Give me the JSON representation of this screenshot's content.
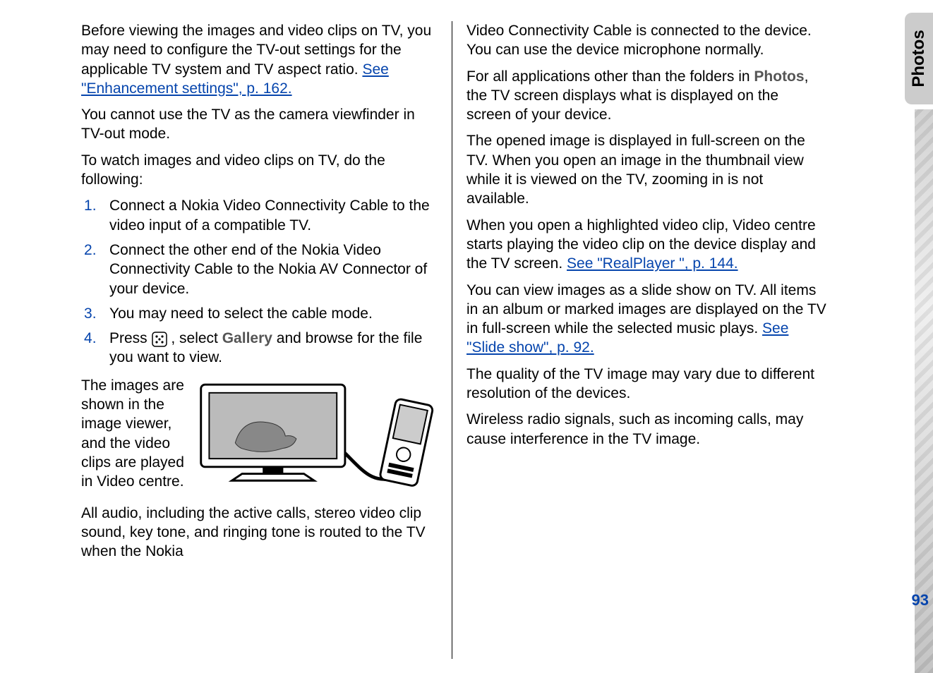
{
  "sideTab": "Photos",
  "pageNumber": "93",
  "left": {
    "p1_prefix": "Before viewing the images and video clips on TV, you may need to configure the TV-out settings for the applicable TV system and TV aspect ratio. ",
    "p1_link": "See \"Enhancement settings\", p. 162.",
    "p2": "You cannot use the TV as the camera viewfinder in TV-out mode.",
    "p3": "To watch images and video clips on TV, do the following:",
    "li1": "Connect a Nokia Video Connectivity Cable to the video input of a compatible TV.",
    "li2": "Connect the other end of the Nokia Video Connectivity Cable to the Nokia AV Connector of your device.",
    "li3": "You may need to select the cable mode.",
    "li4_a": "Press ",
    "li4_b": " , select ",
    "li4_gallery": "Gallery",
    "li4_c": " and browse for the file you want to view.",
    "figtxt": "The images are shown in the image viewer, and the video clips are played in Video centre.",
    "p4": "All audio, including the active calls, stereo video clip sound, key tone, and ringing tone is routed to the TV when the Nokia"
  },
  "right": {
    "p1": "Video Connectivity Cable is connected to the device. You can use the device microphone normally.",
    "p2_a": "For all applications other than the folders in ",
    "p2_photos": "Photos",
    "p2_b": ", the TV screen displays what is displayed on the screen of your device.",
    "p3": "The opened image is displayed in full-screen on the TV. When you open an image in the thumbnail view while it is viewed on the TV, zooming in is not available.",
    "p4_a": "When you open a highlighted video clip, Video centre starts playing the video clip on the device display and the TV screen. ",
    "p4_link": "See \"RealPlayer \", p. 144.",
    "p5_a": "You can view images as a slide show on TV. All items in an album or marked images are displayed on the TV in full-screen while the selected music plays. ",
    "p5_link": "See \"Slide show\", p. 92.",
    "p6": "The quality of the TV image may vary due to different resolution of the devices.",
    "p7": "Wireless radio signals, such as incoming calls, may cause interference in the TV image."
  }
}
